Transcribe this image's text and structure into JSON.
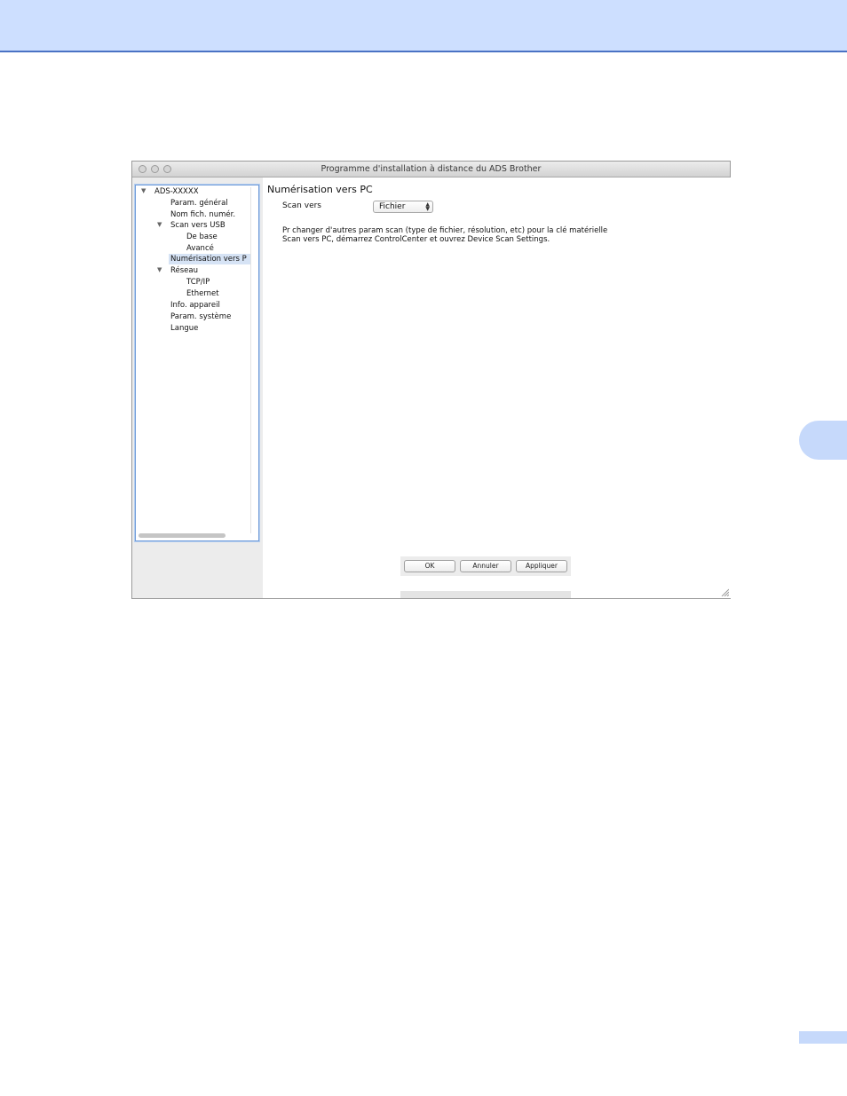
{
  "window": {
    "title": "Programme d'installation à distance du ADS Brother"
  },
  "tree": {
    "items": [
      {
        "label": "ADS-XXXXX",
        "level": 0,
        "expanded": true
      },
      {
        "label": "Param. général",
        "level": 1
      },
      {
        "label": "Nom fich. numér.",
        "level": 1
      },
      {
        "label": "Scan vers USB",
        "level": 1,
        "expanded": true
      },
      {
        "label": "De base",
        "level": 2
      },
      {
        "label": "Avancé",
        "level": 2
      },
      {
        "label": "Numérisation vers P",
        "level": 1,
        "selected": true
      },
      {
        "label": "Réseau",
        "level": 1,
        "expanded": true
      },
      {
        "label": "TCP/IP",
        "level": 2
      },
      {
        "label": "Ethernet",
        "level": 2
      },
      {
        "label": "Info. appareil",
        "level": 1
      },
      {
        "label": "Param. système",
        "level": 1
      },
      {
        "label": "Langue",
        "level": 1
      }
    ]
  },
  "panel": {
    "title": "Numérisation vers PC",
    "scan_to_label": "Scan vers",
    "scan_to_value": "Fichier",
    "info_line1": "Pr changer d'autres param scan (type de fichier, résolution, etc) pour la clé matérielle",
    "info_line2": "Scan vers PC, démarrez ControlCenter et ouvrez Device Scan Settings."
  },
  "buttons": {
    "ok": "OK",
    "cancel": "Annuler",
    "apply": "Appliquer"
  },
  "colors": {
    "header_bg": "#cddfff",
    "header_rule": "#4a72c4",
    "selection": "#d6e3f5"
  }
}
